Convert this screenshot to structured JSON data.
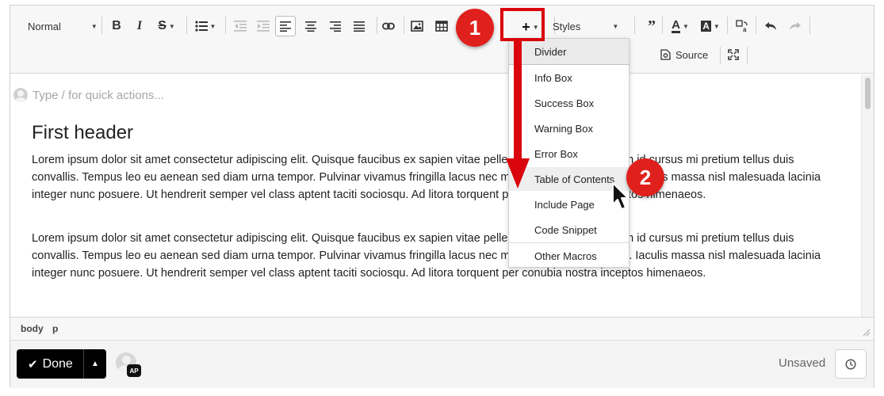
{
  "toolbar": {
    "format_label": "Normal",
    "styles_label": "Styles",
    "source_label": "Source"
  },
  "editor": {
    "quick_actions_placeholder": "Type / for quick actions...",
    "heading": "First header",
    "paragraphs": [
      "Lorem ipsum dolor sit amet consectetur adipiscing elit. Quisque faucibus ex sapien vitae pellentesque sem placerat. In id cursus mi pretium tellus duis convallis. Tempus leo eu aenean sed diam urna tempor. Pulvinar vivamus fringilla lacus nec metus bibendum egestas. Iaculis massa nisl malesuada lacinia integer nunc posuere. Ut hendrerit semper vel class aptent taciti sociosqu. Ad litora torquent per conubia nostra inceptos himenaeos.",
      "Lorem ipsum dolor sit amet consectetur adipiscing elit. Quisque faucibus ex sapien vitae pellentesque sem placerat. In id cursus mi pretium tellus duis convallis. Tempus leo eu aenean sed diam urna tempor. Pulvinar vivamus fringilla lacus nec metus bibendum egestas. Iaculis massa nisl malesuada lacinia integer nunc posuere. Ut hendrerit semper vel class aptent taciti sociosqu. Ad litora torquent per conubia nostra inceptos himenaeos."
    ]
  },
  "statusbar": {
    "path": [
      "body",
      "p"
    ]
  },
  "insert_menu": {
    "items": [
      "Divider",
      "Info Box",
      "Success Box",
      "Warning Box",
      "Error Box",
      "Table of Contents",
      "Include Page",
      "Code Snippet",
      "Other Macros"
    ],
    "highlighted": "Table of Contents"
  },
  "footer": {
    "done_label": "Done",
    "avatar_initials": "AP",
    "status_text": "Unsaved"
  },
  "annotations": {
    "step1": "1",
    "step2": "2",
    "color": "#d9040c"
  },
  "colors": {
    "badge_red": "#e0201c",
    "toolbar_bg": "#f7f7f7",
    "done_bg": "#000000"
  }
}
